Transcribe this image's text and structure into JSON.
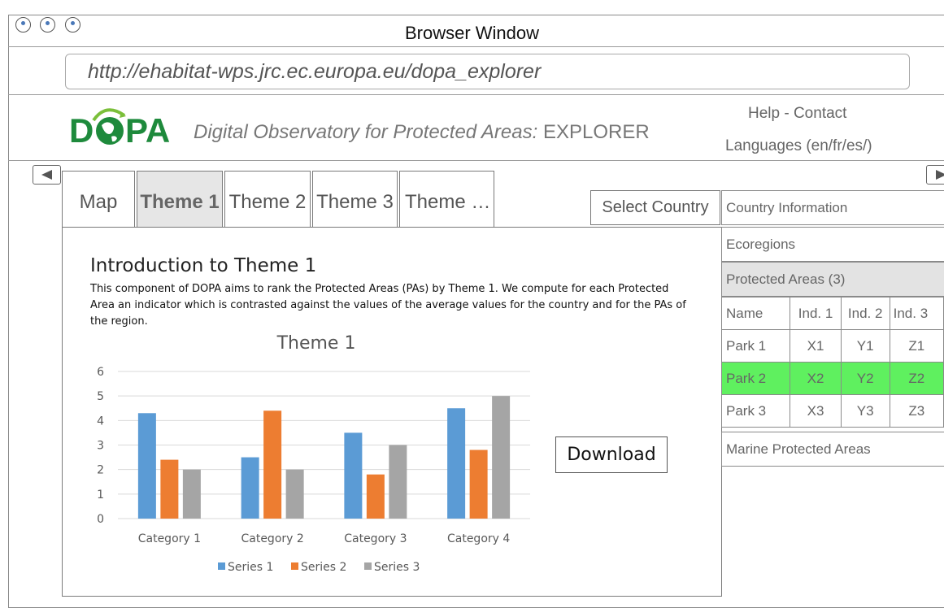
{
  "window": {
    "title": "Browser Window",
    "url": "http://ehabitat-wps.jrc.ec.europa.eu/dopa_explorer"
  },
  "header": {
    "logo_text_left": "D",
    "logo_text_right": "PA",
    "title_italic": "Digital Observatory for Protected Areas:",
    "title_suffix": " EXPLORER",
    "help_contact": "Help - Contact",
    "languages": "Languages (en/fr/es/)"
  },
  "tabs": [
    {
      "label": "Map",
      "active": false
    },
    {
      "label": "Theme 1",
      "active": true
    },
    {
      "label": "Theme 2",
      "active": false
    },
    {
      "label": "Theme 3",
      "active": false
    },
    {
      "label": "Theme …",
      "active": false
    }
  ],
  "select_country": "Select Country",
  "intro": {
    "title": "Introduction to Theme 1",
    "text": "This component of DOPA aims to rank the Protected Areas (PAs) by Theme 1. We compute for each Protected Area an indicator which is contrasted against the values of the average values for the country and for the PAs of the region."
  },
  "download_label": "Download",
  "right_panel": {
    "country_information": "Country Information",
    "ecoregions": "Ecoregions",
    "protected_areas": "Protected Areas (3)",
    "table": {
      "columns": [
        "Name",
        "Ind. 1",
        "Ind. 2",
        "Ind. 3"
      ],
      "rows": [
        [
          "Park 1",
          "X1",
          "Y1",
          "Z1"
        ],
        [
          "Park 2",
          "X2",
          "Y2",
          "Z2"
        ],
        [
          "Park 3",
          "X3",
          "Y3",
          "Z3"
        ]
      ],
      "highlighted_row": 1,
      "highlight_color": "#5ff05f"
    },
    "marine_protected_areas": "Marine Protected Areas"
  },
  "chart_data": {
    "type": "bar",
    "title": "Theme 1",
    "categories": [
      "Category 1",
      "Category 2",
      "Category 3",
      "Category 4"
    ],
    "series": [
      {
        "name": "Series 1",
        "values": [
          4.3,
          2.5,
          3.5,
          4.5
        ],
        "color": "#5b9bd5"
      },
      {
        "name": "Series 2",
        "values": [
          2.4,
          4.4,
          1.8,
          2.8
        ],
        "color": "#ed7d31"
      },
      {
        "name": "Series 3",
        "values": [
          2,
          2,
          3,
          5
        ],
        "color": "#a5a5a5"
      }
    ],
    "ylim": [
      0,
      6
    ],
    "yticks": [
      "0",
      "1",
      "2",
      "3",
      "4",
      "5",
      "6"
    ],
    "grid": true,
    "legend": "bottom"
  }
}
